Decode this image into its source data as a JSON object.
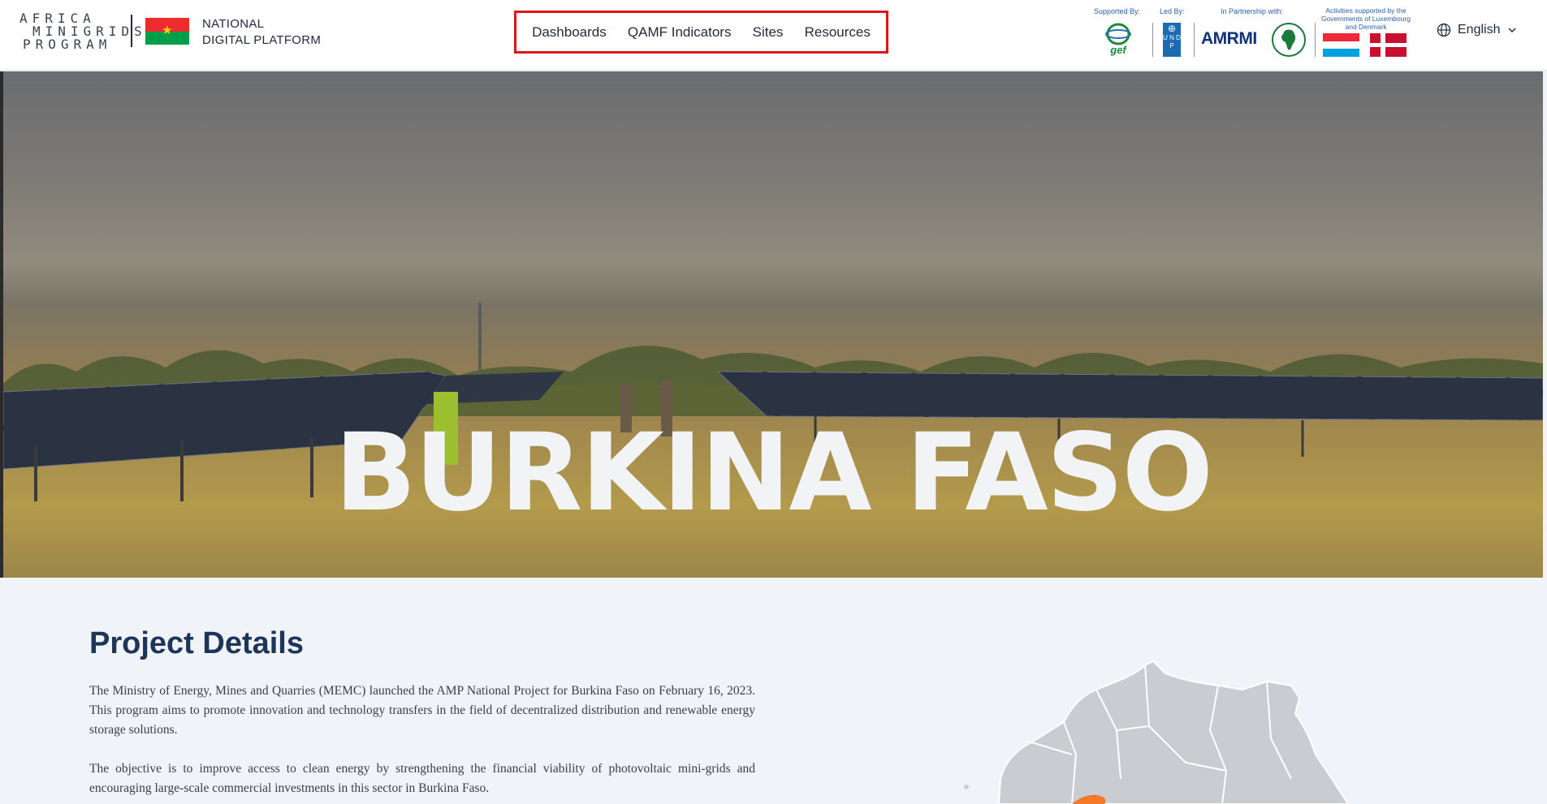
{
  "brand": {
    "logo_lines": [
      "AFRICA",
      "MINIGRIDS",
      "PROGRAM"
    ],
    "platform_line1": "NATIONAL",
    "platform_line2": "DIGITAL PLATFORM"
  },
  "nav": {
    "items": [
      {
        "label": "Dashboards"
      },
      {
        "label": "QAMF Indicators"
      },
      {
        "label": "Sites"
      },
      {
        "label": "Resources"
      }
    ]
  },
  "partners": {
    "supported_by": "Supported By:",
    "led_by": "Led By:",
    "in_partnership": "In Partnership with:",
    "activities_supported": "Activities supported by the Governments of Luxembourg and Denmark",
    "gef_label": "gef",
    "undp_label": "U N D P",
    "amrmi_label": "AMRMI"
  },
  "language": {
    "selected": "English"
  },
  "hero": {
    "title": "BURKINA FASO"
  },
  "project": {
    "title": "Project Details",
    "paragraph1": "The Ministry of Energy, Mines and Quarries (MEMC) launched the AMP National Project for Burkina Faso on February 16, 2023. This program aims to promote innovation and technology transfers in the field of decentralized distribution and renewable energy storage solutions.",
    "paragraph2": "The objective is to improve access to clean energy by strengthening the financial viability of photovoltaic mini-grids and encouraging large-scale commercial investments in this sector in Burkina Faso."
  },
  "colors": {
    "nav_highlight": "#e1141c",
    "title_blue": "#1c3559",
    "burkina_highlight": "#f47a2a",
    "map_gray": "#c9ccd0"
  }
}
